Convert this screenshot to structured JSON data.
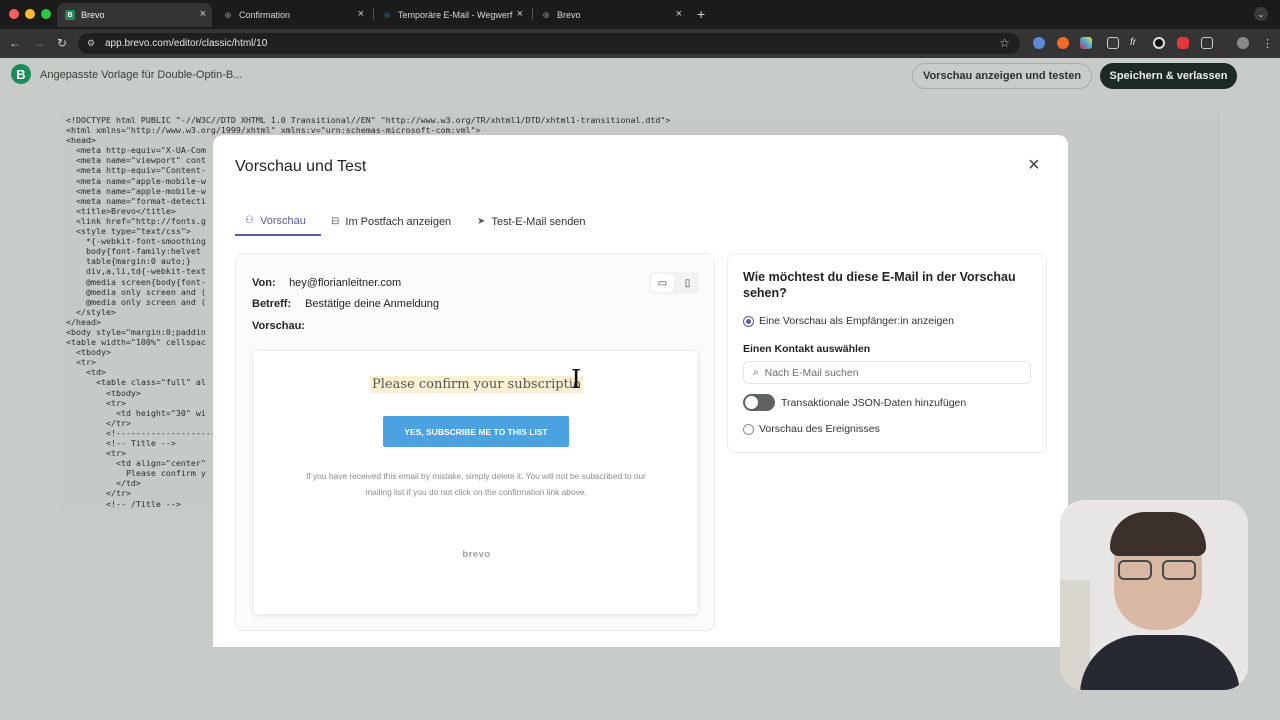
{
  "browser": {
    "tabs": [
      {
        "label": "Brevo",
        "fav": "B",
        "fav_color": "#1e8c5a"
      },
      {
        "label": "Confirmation",
        "fav": "◎",
        "fav_color": "#555555"
      },
      {
        "label": "Temporäre E-Mail - Wegwerf",
        "fav": "◎",
        "fav_color": "#2a8fa8"
      },
      {
        "label": "Brevo",
        "fav": "◎",
        "fav_color": "#555555"
      }
    ],
    "url": "app.brevo.com/editor/classic/html/10"
  },
  "app": {
    "title": "Angepasste Vorlage für Double-Optin-B...",
    "preview_button": "Vorschau anzeigen und testen",
    "save_button": "Speichern & verlassen"
  },
  "code_lines": [
    "<!DOCTYPE html PUBLIC \"-//W3C//DTD XHTML 1.0 Transitional//EN\" \"http://www.w3.org/TR/xhtml1/DTD/xhtml1-transitional.dtd\">",
    "<html xmlns=\"http://www.w3.org/1999/xhtml\" xmlns:v=\"urn:schemas-microsoft-com:vml\">",
    "<head>",
    "  <meta http-equiv=\"X-UA-Com",
    "  <meta name=\"viewport\" cont",
    "  <meta http-equiv=\"Content-",
    "  <meta name=\"apple-mobile-w",
    "  <meta name=\"apple-mobile-w",
    "  <meta name=\"format-detecti",
    "  <title>Brevo</title>",
    "  <link href=\"http://fonts.g",
    "  <style type=\"text/css\">",
    "    *{-webkit-font-smoothing",
    "    body{font-family:helvet",
    "    table{margin:0 auto;}",
    "    div,a,li,td{-webkit-text",
    "    @media screen{body{font-",
    "    @media only screen and (",
    "    @media only screen and (",
    "  </style>",
    "</head>",
    "<body style=\"margin:0;paddin",
    "<table width=\"100%\" cellspac",
    "  <tbody>",
    "  <tr>",
    "    <td>",
    "      <table class=\"full\" al",
    "        <tbody>",
    "        <tr>",
    "          <td height=\"30\" wi",
    "        </tr>",
    "        <!-----------------------",
    "        <!-- Title -->",
    "        <tr>",
    "          <td align=\"center\"",
    "            Please confirm y",
    "          </td>",
    "        </tr>",
    "        <!-- /Title -->",
    "        <tr>"
  ],
  "modal": {
    "title": "Vorschau und Test",
    "close": "×",
    "tabs": [
      {
        "label": "Vorschau",
        "icon": "user-icon"
      },
      {
        "label": "Im Postfach anzeigen",
        "icon": "inbox-icon"
      },
      {
        "label": "Test-E-Mail senden",
        "icon": "send-icon"
      }
    ],
    "from_label": "Von:",
    "from_value": "hey@florianleitner.com",
    "subject_label": "Betreff:",
    "subject_value": "Bestätige deine Anmeldung",
    "preview_label": "Vorschau:",
    "email": {
      "title": "Please confirm your subscriptio",
      "button": "YES, SUBSCRIBE ME TO THIS LIST",
      "note": "If you have received this email by mistake, simply delete it. You will not be subscribed to our mailing list if you do not click on the confirmation link above.",
      "brand": "brevo"
    },
    "options": {
      "question": "Wie möchtest du diese E-Mail in der Vorschau sehen?",
      "radio_recipient": "Eine Vorschau als Empfänger:in anzeigen",
      "contact_label": "Einen Kontakt auswählen",
      "search_placeholder": "Nach E-Mail suchen",
      "toggle_label": "Transaktionale JSON-Daten hinzufügen",
      "radio_event": "Vorschau des Ereignisses"
    }
  },
  "colors": {
    "accent": "#5b5aa8",
    "brand": "#1e8c5a",
    "subscribe_button": "#4aa3e0"
  }
}
